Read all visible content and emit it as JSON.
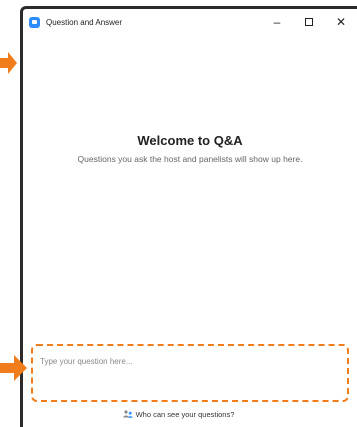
{
  "window": {
    "title": "Question and Answer",
    "controls": {
      "minimize": "–",
      "close": "✕"
    }
  },
  "welcome": {
    "heading": "Welcome to Q&A",
    "description": "Questions you ask the host and panelists will show up here."
  },
  "question_input": {
    "placeholder": "Type your question here..."
  },
  "footer": {
    "who_can_see": "Who can see your questions?"
  },
  "colors": {
    "accent_orange": "#f07c1b",
    "app_blue": "#2d8cff"
  },
  "icons": [
    "zoom-app-icon",
    "minimize-icon",
    "maximize-icon",
    "close-icon",
    "people-icon",
    "arrow-icon"
  ]
}
